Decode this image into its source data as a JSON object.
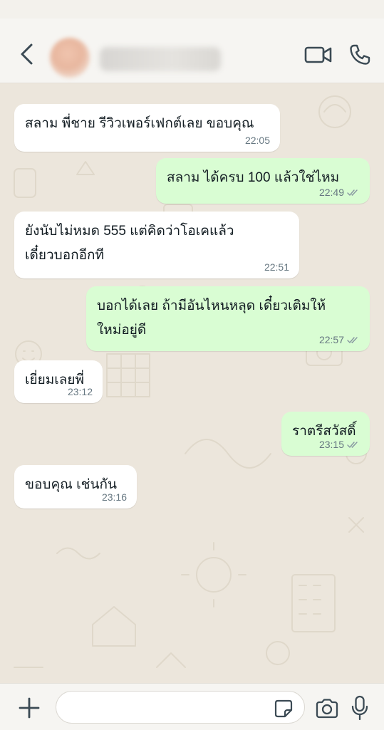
{
  "header": {
    "back_icon": "chevron-left-icon",
    "video_icon": "video-camera-icon",
    "call_icon": "phone-icon"
  },
  "messages": [
    {
      "dir": "in",
      "lines": [
        "สลาม พี่ชาย รีวิวเพอร์เฟกต์เลย ขอบคุณ"
      ],
      "time": "22:05"
    },
    {
      "dir": "out",
      "lines": [
        "สลาม ได้ครบ 100 แล้วใช่ไหม"
      ],
      "time": "22:49",
      "status": "read"
    },
    {
      "dir": "in",
      "lines": [
        "ยังนับไม่หมด 555 แต่คิดว่าโอเคแล้ว",
        "เดี๋ยวบอกอีกที"
      ],
      "time": "22:51"
    },
    {
      "dir": "out",
      "lines": [
        "บอกได้เลย ถ้ามีอันไหนหลุด เดี๋ยวเติมให้",
        "ใหม่อยู่ดี"
      ],
      "time": "22:57",
      "status": "read"
    },
    {
      "dir": "in",
      "lines": [
        "เยี่ยมเลยพี่"
      ],
      "time": "23:12"
    },
    {
      "dir": "out",
      "lines": [
        "ราตรีสวัสดิ์"
      ],
      "time": "23:15",
      "status": "read"
    },
    {
      "dir": "in",
      "lines": [
        "ขอบคุณ เช่นกัน"
      ],
      "time": "23:16"
    }
  ],
  "composer": {
    "placeholder": "",
    "plus_icon": "plus-icon",
    "sticker_icon": "sticker-icon",
    "camera_icon": "camera-icon",
    "mic_icon": "microphone-icon"
  },
  "colors": {
    "incoming_bubble": "#ffffff",
    "outgoing_bubble": "#d9fdd3",
    "chat_background": "#ece6dc",
    "tick_color": "#8696a0"
  }
}
